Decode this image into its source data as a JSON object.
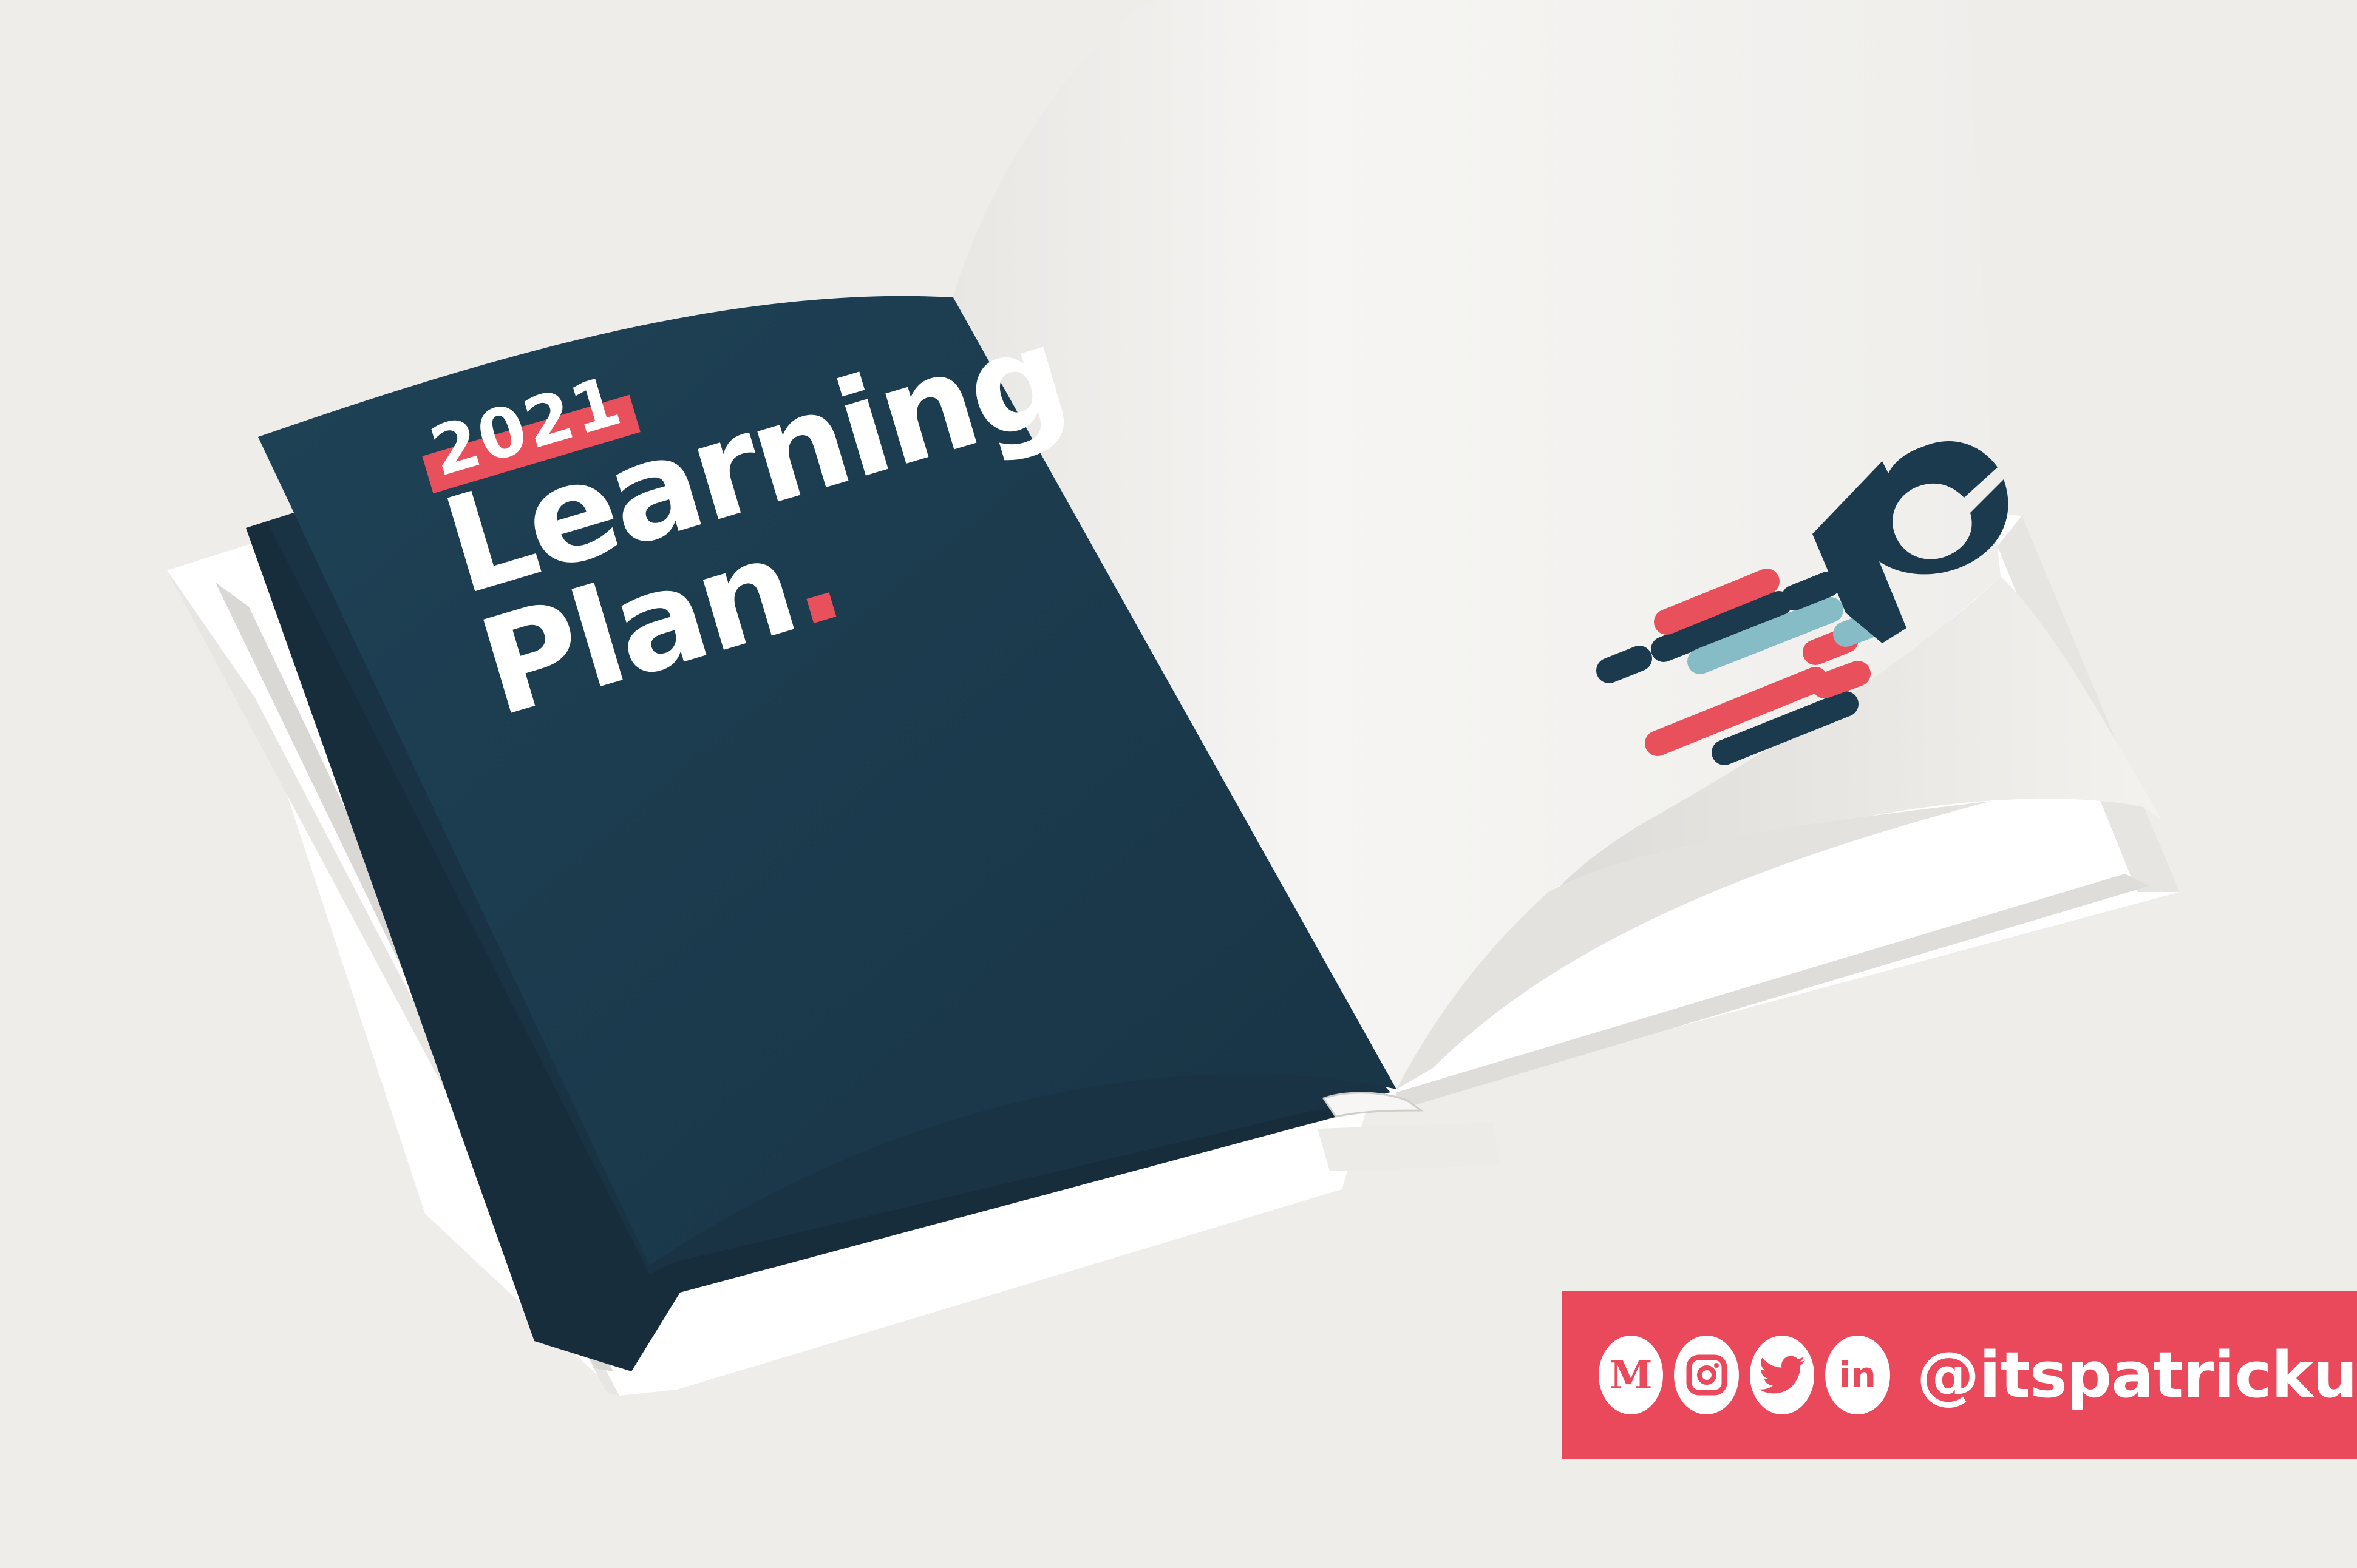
{
  "notebook": {
    "cover": {
      "year": "2021",
      "title_line1": "Learning",
      "title_line2": "Plan",
      "title_dot": "."
    },
    "colors": {
      "cover_navy": "#1c3a4d",
      "accent_red": "#e8505b",
      "accent_teal": "#86bcc6",
      "page": "#f4f3f1",
      "background": "#eeedea"
    }
  },
  "social": {
    "icons": [
      "medium-icon",
      "instagram-icon",
      "twitter-icon",
      "linkedin-icon"
    ],
    "medium_glyph": "M",
    "linkedin_glyph": "in",
    "handle": "@itspatricku"
  }
}
